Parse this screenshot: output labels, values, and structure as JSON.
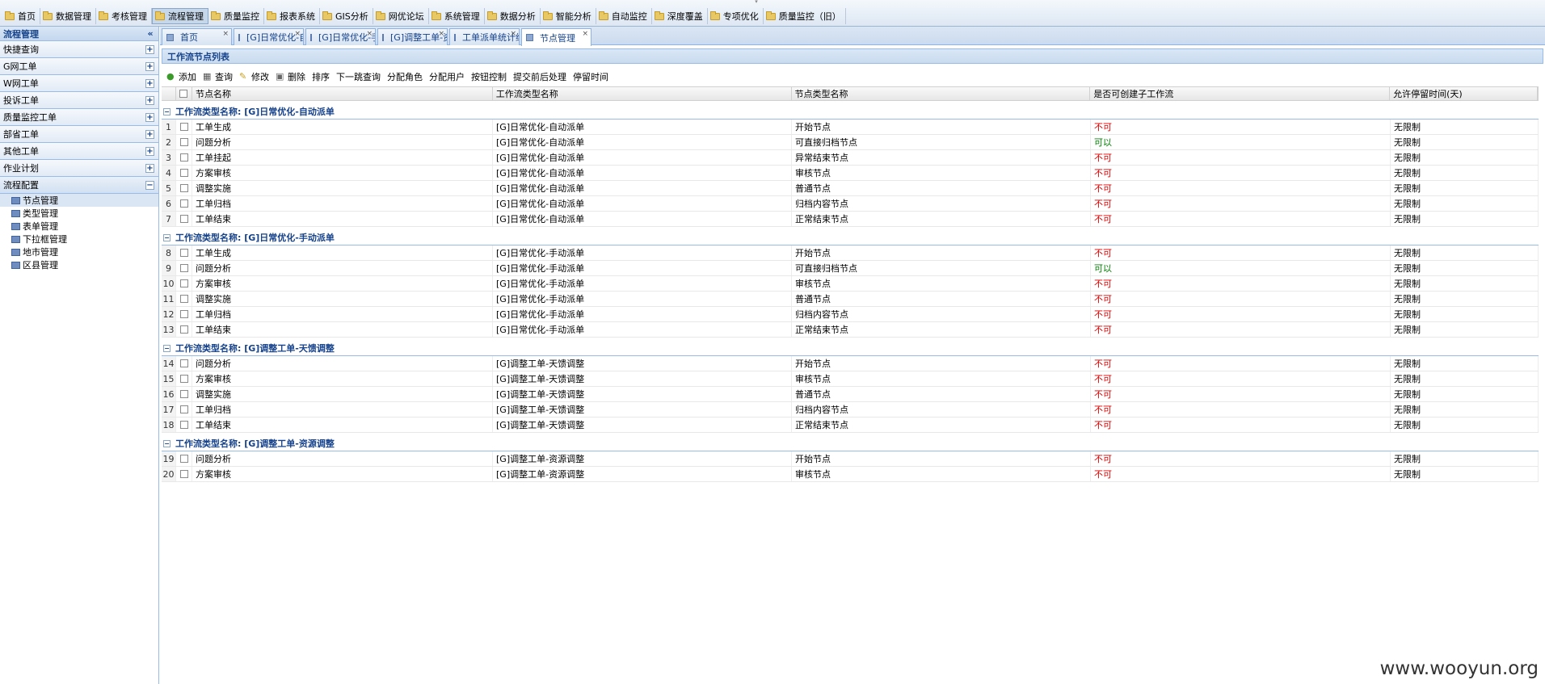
{
  "top_menu": [
    "首页",
    "数据管理",
    "考核管理",
    "流程管理",
    "质量监控",
    "报表系统",
    "GIS分析",
    "网优论坛",
    "系统管理",
    "数据分析",
    "智能分析",
    "自动监控",
    "深度覆盖",
    "专项优化",
    "质量监控（旧）"
  ],
  "top_menu_active": "流程管理",
  "sidebar": {
    "title": "流程管理",
    "groups": [
      {
        "label": "快捷查询",
        "state": "+"
      },
      {
        "label": "G网工单",
        "state": "+"
      },
      {
        "label": "W网工单",
        "state": "+"
      },
      {
        "label": "投诉工单",
        "state": "+"
      },
      {
        "label": "质量监控工单",
        "state": "+"
      },
      {
        "label": "部省工单",
        "state": "+"
      },
      {
        "label": "其他工单",
        "state": "+"
      },
      {
        "label": "作业计划",
        "state": "+"
      },
      {
        "label": "流程配置",
        "state": "−"
      }
    ],
    "items": [
      "节点管理",
      "类型管理",
      "表单管理",
      "下拉框管理",
      "地市管理",
      "区县管理"
    ]
  },
  "tabs": [
    "首页",
    "[G]日常优化-自",
    "[G]日常优化-手",
    "[G]调整工单-资",
    "工单派单统计绩",
    "节点管理"
  ],
  "panel_title": "工作流节点列表",
  "toolbar": [
    "添加",
    "查询",
    "修改",
    "删除",
    "排序",
    "下一跳查询",
    "分配角色",
    "分配用户",
    "按钮控制",
    "提交前后处理",
    "停留时间"
  ],
  "columns": [
    "节点名称",
    "工作流类型名称",
    "节点类型名称",
    "是否可创建子工作流",
    "允许停留时间(天)"
  ],
  "groups": [
    {
      "label": "工作流类型名称: [G]日常优化-自动派单",
      "rows": [
        {
          "n": "1",
          "name": "工单生成",
          "wf": "[G]日常优化-自动派单",
          "type": "开始节点",
          "sub": "不可",
          "time": "无限制"
        },
        {
          "n": "2",
          "name": "问题分析",
          "wf": "[G]日常优化-自动派单",
          "type": "可直接归档节点",
          "sub": "可以",
          "time": "无限制"
        },
        {
          "n": "3",
          "name": "工单挂起",
          "wf": "[G]日常优化-自动派单",
          "type": "异常结束节点",
          "sub": "不可",
          "time": "无限制"
        },
        {
          "n": "4",
          "name": "方案审核",
          "wf": "[G]日常优化-自动派单",
          "type": "审核节点",
          "sub": "不可",
          "time": "无限制"
        },
        {
          "n": "5",
          "name": "调整实施",
          "wf": "[G]日常优化-自动派单",
          "type": "普通节点",
          "sub": "不可",
          "time": "无限制"
        },
        {
          "n": "6",
          "name": "工单归档",
          "wf": "[G]日常优化-自动派单",
          "type": "归档内容节点",
          "sub": "不可",
          "time": "无限制"
        },
        {
          "n": "7",
          "name": "工单结束",
          "wf": "[G]日常优化-自动派单",
          "type": "正常结束节点",
          "sub": "不可",
          "time": "无限制"
        }
      ]
    },
    {
      "label": "工作流类型名称: [G]日常优化-手动派单",
      "rows": [
        {
          "n": "8",
          "name": "工单生成",
          "wf": "[G]日常优化-手动派单",
          "type": "开始节点",
          "sub": "不可",
          "time": "无限制"
        },
        {
          "n": "9",
          "name": "问题分析",
          "wf": "[G]日常优化-手动派单",
          "type": "可直接归档节点",
          "sub": "可以",
          "time": "无限制"
        },
        {
          "n": "10",
          "name": "方案审核",
          "wf": "[G]日常优化-手动派单",
          "type": "审核节点",
          "sub": "不可",
          "time": "无限制"
        },
        {
          "n": "11",
          "name": "调整实施",
          "wf": "[G]日常优化-手动派单",
          "type": "普通节点",
          "sub": "不可",
          "time": "无限制"
        },
        {
          "n": "12",
          "name": "工单归档",
          "wf": "[G]日常优化-手动派单",
          "type": "归档内容节点",
          "sub": "不可",
          "time": "无限制"
        },
        {
          "n": "13",
          "name": "工单结束",
          "wf": "[G]日常优化-手动派单",
          "type": "正常结束节点",
          "sub": "不可",
          "time": "无限制"
        }
      ]
    },
    {
      "label": "工作流类型名称: [G]调整工单-天馈调整",
      "rows": [
        {
          "n": "14",
          "name": "问题分析",
          "wf": "[G]调整工单-天馈调整",
          "type": "开始节点",
          "sub": "不可",
          "time": "无限制"
        },
        {
          "n": "15",
          "name": "方案审核",
          "wf": "[G]调整工单-天馈调整",
          "type": "审核节点",
          "sub": "不可",
          "time": "无限制"
        },
        {
          "n": "16",
          "name": "调整实施",
          "wf": "[G]调整工单-天馈调整",
          "type": "普通节点",
          "sub": "不可",
          "time": "无限制"
        },
        {
          "n": "17",
          "name": "工单归档",
          "wf": "[G]调整工单-天馈调整",
          "type": "归档内容节点",
          "sub": "不可",
          "time": "无限制"
        },
        {
          "n": "18",
          "name": "工单结束",
          "wf": "[G]调整工单-天馈调整",
          "type": "正常结束节点",
          "sub": "不可",
          "time": "无限制"
        }
      ]
    },
    {
      "label": "工作流类型名称: [G]调整工单-资源调整",
      "rows": [
        {
          "n": "19",
          "name": "问题分析",
          "wf": "[G]调整工单-资源调整",
          "type": "开始节点",
          "sub": "不可",
          "time": "无限制"
        },
        {
          "n": "20",
          "name": "方案审核",
          "wf": "[G]调整工单-资源调整",
          "type": "审核节点",
          "sub": "不可",
          "time": "无限制"
        }
      ]
    }
  ],
  "watermark": "www.wooyun.org"
}
